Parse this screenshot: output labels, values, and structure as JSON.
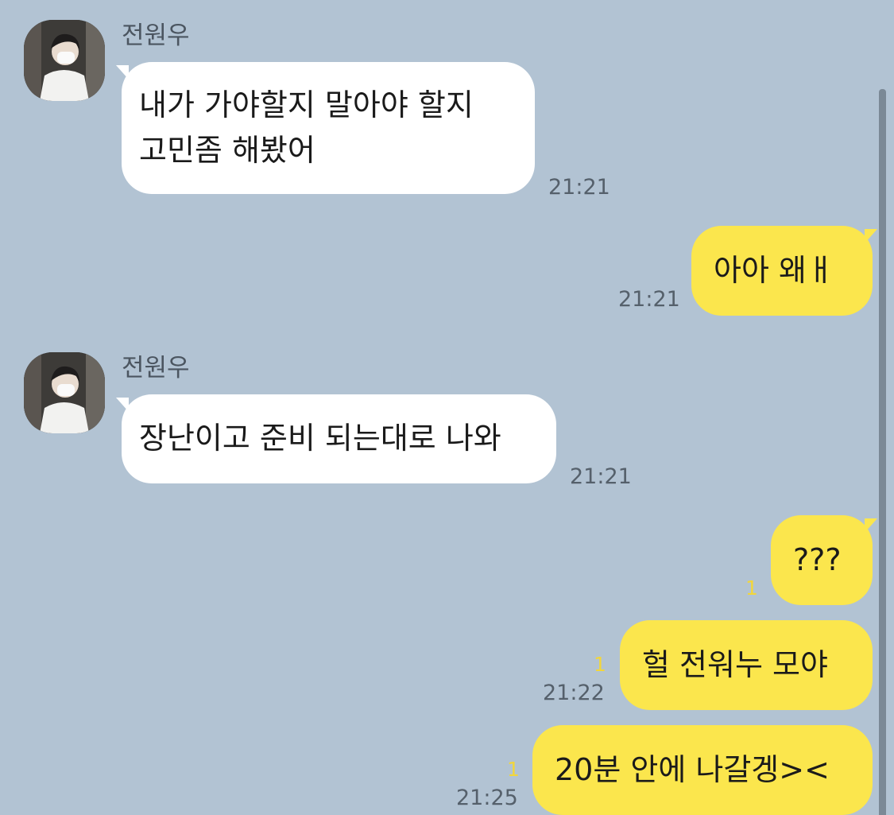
{
  "messages": [
    {
      "sender": "전원우",
      "text_lines": [
        "내가 가야할지 말아야 할지",
        "고민좀 해봤어"
      ],
      "time": "21:21"
    },
    {
      "text": "아아 왜ㅐ",
      "time": "21:21"
    },
    {
      "sender": "전원우",
      "text": "장난이고 준비 되는대로 나와",
      "time": "21:21"
    },
    {
      "text": "???",
      "unread": "1"
    },
    {
      "text": "헐 전워누 모야",
      "unread": "1",
      "time": "21:22"
    },
    {
      "text": "20분 안에 나갈겡><",
      "unread": "1",
      "time": "21:25"
    }
  ],
  "colors": {
    "background": "#b2c3d3",
    "incoming_bubble": "#ffffff",
    "outgoing_bubble": "#fbe64d",
    "unread_count": "#f2d63b",
    "timestamp": "#55606b"
  },
  "icons": [
    "avatar-photo"
  ]
}
